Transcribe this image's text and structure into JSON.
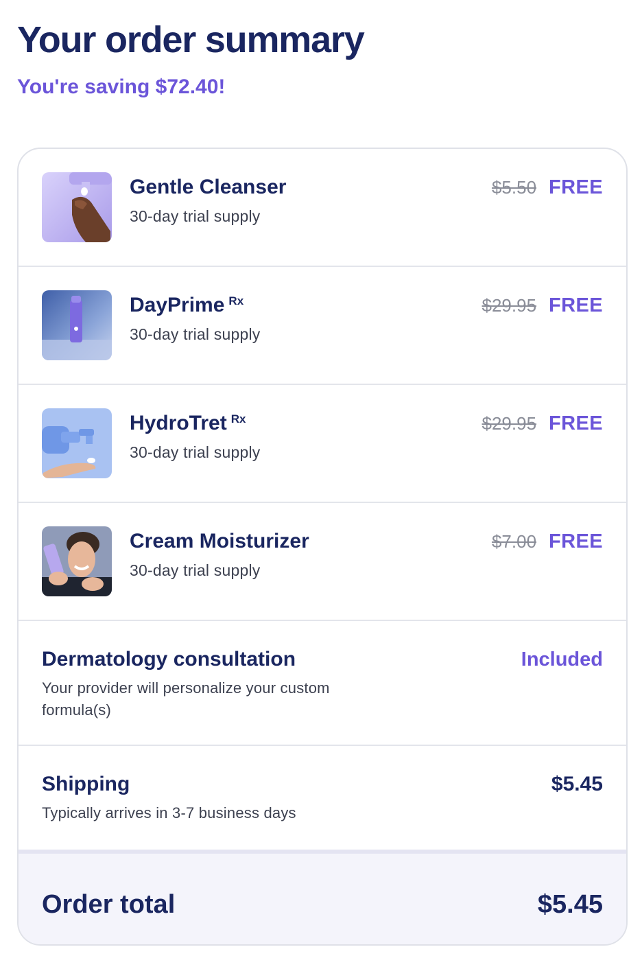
{
  "header": {
    "title": "Your order summary",
    "saving": "You're saving $72.40!"
  },
  "items": [
    {
      "name": "Gentle Cleanser",
      "rx": "",
      "subtitle": "30-day trial supply",
      "original_price": "$5.50",
      "price": "FREE",
      "image": "cleanser-pump-photo"
    },
    {
      "name": "DayPrime",
      "rx": "Rx",
      "subtitle": "30-day trial supply",
      "original_price": "$29.95",
      "price": "FREE",
      "image": "dayprime-bottle-photo"
    },
    {
      "name": "HydroTret",
      "rx": "Rx",
      "subtitle": "30-day trial supply",
      "original_price": "$29.95",
      "price": "FREE",
      "image": "hydrotret-pump-photo"
    },
    {
      "name": "Cream Moisturizer",
      "rx": "",
      "subtitle": "30-day trial supply",
      "original_price": "$7.00",
      "price": "FREE",
      "image": "moisturizer-model-photo"
    }
  ],
  "consultation": {
    "name": "Dermatology consultation",
    "subtitle": "Your provider will personalize your custom formula(s)",
    "price": "Included"
  },
  "shipping": {
    "name": "Shipping",
    "subtitle": "Typically arrives in 3-7 business days",
    "price": "$5.45"
  },
  "total": {
    "label": "Order total",
    "value": "$5.45"
  },
  "colors": {
    "navy": "#1a2660",
    "accent": "#6b55d9",
    "muted": "#8a8d98",
    "total_bg": "#f4f4fb"
  }
}
